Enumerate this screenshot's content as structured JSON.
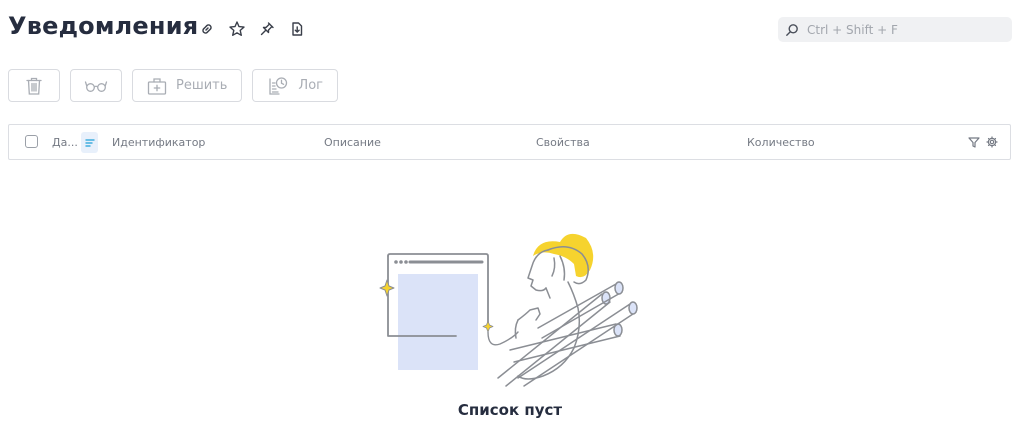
{
  "header": {
    "title": "Уведомления",
    "icons": [
      "link-icon",
      "star-icon",
      "pin-icon",
      "export-icon"
    ]
  },
  "search": {
    "placeholder": "Ctrl + Shift + F"
  },
  "toolbar": {
    "delete_icon": "trash-icon",
    "view_icon": "glasses-icon",
    "resolve_label": "Решить",
    "log_label": "Лог"
  },
  "table": {
    "columns": [
      "Да...",
      "Идентификатор",
      "Описание",
      "Свойства",
      "Количество"
    ]
  },
  "empty": {
    "message": "Список пуст"
  },
  "colors": {
    "accent": "#1f9fd8",
    "illustration_fill": "#dbe3f8",
    "hair": "#f6d32e"
  }
}
